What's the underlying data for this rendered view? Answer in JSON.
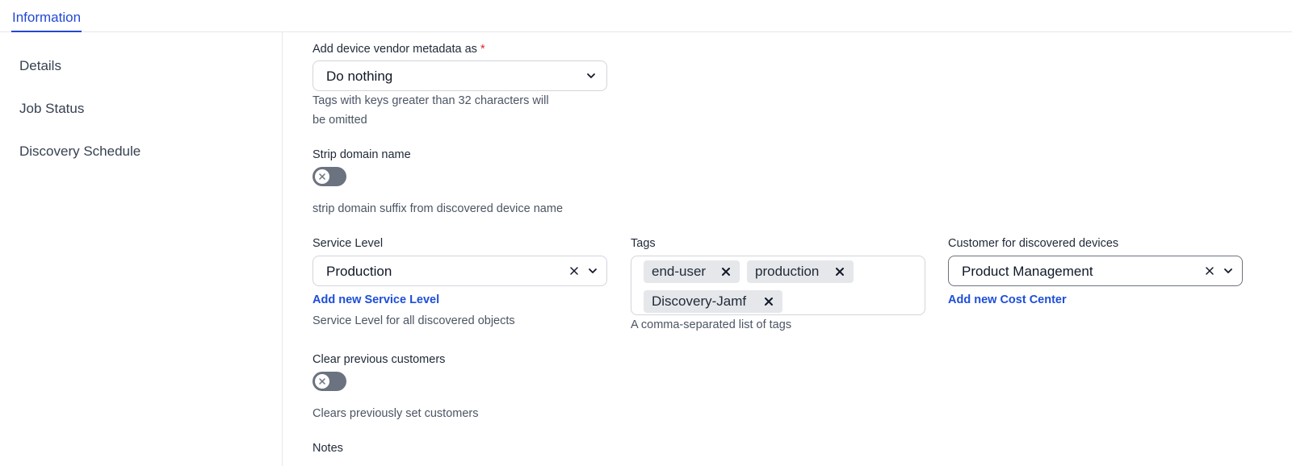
{
  "tabs": {
    "active": "Information"
  },
  "sidebar": {
    "items": [
      {
        "label": "Details"
      },
      {
        "label": "Job Status"
      },
      {
        "label": "Discovery Schedule"
      }
    ]
  },
  "vendor_metadata": {
    "label": "Add device vendor metadata as",
    "required_mark": "*",
    "value": "Do nothing",
    "help_line1": "Tags with keys greater than 32 characters will",
    "help_line2": "be omitted"
  },
  "strip_domain": {
    "label": "Strip domain name",
    "enabled": false,
    "help": "strip domain suffix from discovered device name"
  },
  "service_level": {
    "label": "Service Level",
    "value": "Production",
    "add_link": "Add new Service Level",
    "help": "Service Level for all discovered objects"
  },
  "tags": {
    "label": "Tags",
    "chips": [
      "end-user",
      "production",
      "Discovery-Jamf"
    ],
    "help": "A comma-separated list of tags"
  },
  "customer": {
    "label": "Customer for discovered devices",
    "value": "Product Management",
    "add_link": "Add new Cost Center"
  },
  "clear_customers": {
    "label": "Clear previous customers",
    "enabled": false,
    "help": "Clears previously set customers"
  },
  "notes": {
    "label": "Notes"
  },
  "colors": {
    "accent": "#2348d6",
    "link": "#1d4ed8",
    "required": "#dc2626",
    "toggle_off": "#6b7280"
  }
}
